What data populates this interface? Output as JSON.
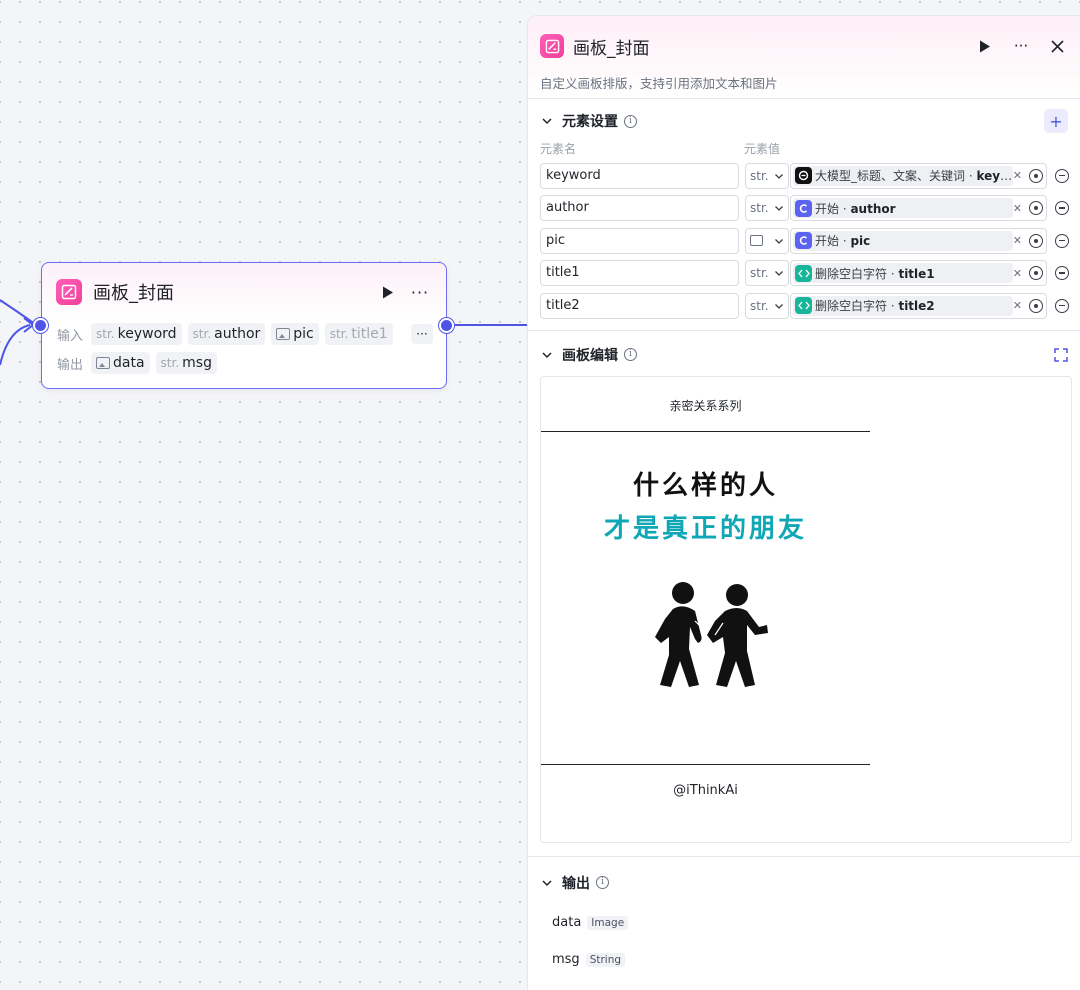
{
  "colors": {
    "accent": "#4e55e6",
    "node_border": "#6f6cf2",
    "app_icon": "#f0409a",
    "teal_text": "#0fa7b5",
    "canvas_bg": "#f4f5f8"
  },
  "node": {
    "title": "画板_封面",
    "input_label": "输入",
    "output_label": "输出",
    "inputs": [
      {
        "type": "str.",
        "name": "keyword"
      },
      {
        "type": "str.",
        "name": "author"
      },
      {
        "type": "image-icon",
        "name": "pic"
      },
      {
        "type": "str.",
        "name": "title1"
      }
    ],
    "outputs": [
      {
        "type": "image-icon",
        "name": "data"
      },
      {
        "type": "str.",
        "name": "msg"
      }
    ],
    "more_label": "···"
  },
  "panel": {
    "title": "画板_封面",
    "description": "自定义画板排版，支持引用添加文本和图片",
    "elements_section": {
      "title": "元素设置",
      "col_name": "元素名",
      "col_value": "元素值",
      "rows": [
        {
          "name": "keyword",
          "type": "str.",
          "source_icon": "llm-icon",
          "source": "大模型_标题、文案、关键词 · ",
          "field": "key···"
        },
        {
          "name": "author",
          "type": "str.",
          "source_icon": "start-icon",
          "source": "开始 · ",
          "field": "author"
        },
        {
          "name": "pic",
          "type": "image-icon",
          "source_icon": "start-icon",
          "source": "开始 · ",
          "field": "pic"
        },
        {
          "name": "title1",
          "type": "str.",
          "source_icon": "code-icon",
          "source": "删除空白字符 · ",
          "field": "title1"
        },
        {
          "name": "title2",
          "type": "str.",
          "source_icon": "code-icon",
          "source": "删除空白字符 · ",
          "field": "title2"
        }
      ]
    },
    "canvas_section": {
      "title": "画板编辑",
      "poster": {
        "series": "亲密关系系列",
        "line1": "什么样的人",
        "line2": "才是真正的朋友",
        "author": "@iThinkAi"
      }
    },
    "output_section": {
      "title": "输出",
      "items": [
        {
          "name": "data",
          "type": "Image"
        },
        {
          "name": "msg",
          "type": "String"
        }
      ]
    }
  }
}
